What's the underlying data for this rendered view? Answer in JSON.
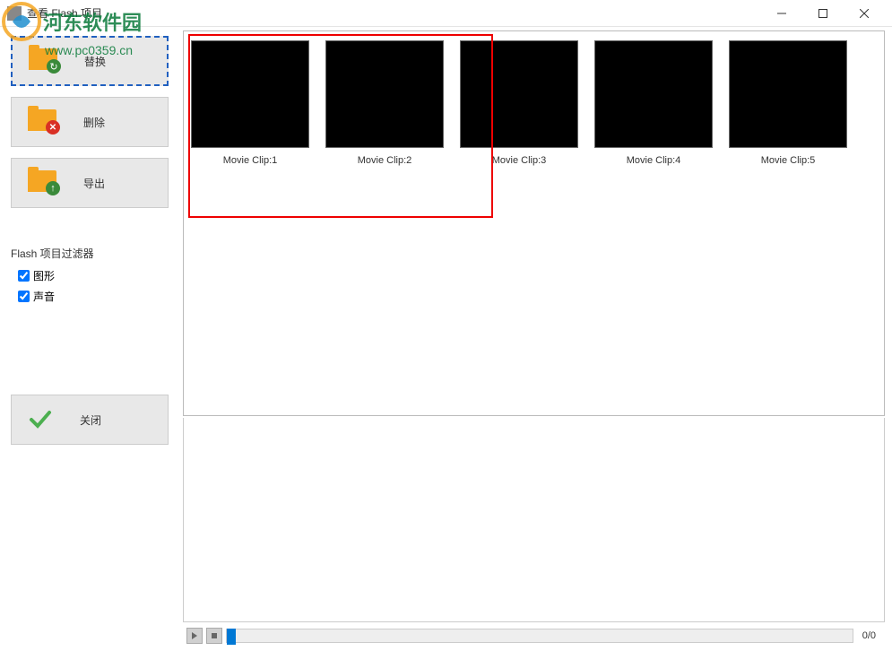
{
  "window": {
    "title": "查看 Flash 项目"
  },
  "watermark": {
    "text": "河东软件园",
    "url": "www.pc0359.cn"
  },
  "sidebar": {
    "replace_label": "替换",
    "delete_label": "删除",
    "export_label": "导出",
    "close_label": "关闭"
  },
  "filter": {
    "title": "Flash 项目过滤器",
    "graphics_label": "图形",
    "sound_label": "声音"
  },
  "clips": [
    {
      "label": "Movie Clip:1"
    },
    {
      "label": "Movie Clip:2"
    },
    {
      "label": "Movie Clip:3"
    },
    {
      "label": "Movie Clip:4"
    },
    {
      "label": "Movie Clip:5"
    }
  ],
  "playback": {
    "counter": "0/0"
  }
}
